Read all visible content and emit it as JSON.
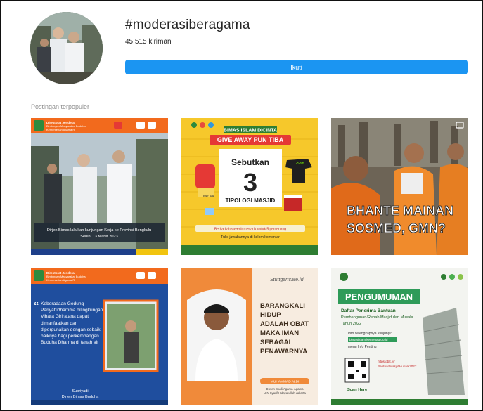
{
  "header": {
    "hashtag": "#moderasiberagama",
    "post_count": "45.515 kiriman",
    "follow_label": "Ikuti"
  },
  "section": {
    "title": "Postingan terpopuler"
  },
  "posts": [
    {
      "header_line1": "Direktorat Jenderal",
      "header_line2": "Bimbingan Masyarakat Buddha",
      "header_line3": "Kementerian Agama RI",
      "caption_line1": "Dirjen Bimas lakukan kunjungan Kerja ke Provinsi Bengkulu",
      "caption_line2": "Senin, 13 Maret 2023"
    },
    {
      "banner": "BIMAS ISLAM DICINTA",
      "ribbon": "GIVE AWAY PUN TIBA",
      "lead": "Sebutkan",
      "number": "3",
      "subject": "TIPOLOGI MASJID",
      "prize": "Berhadiah suvenir menarik untuk 5 pemenang",
      "cta": "Tulis jawabannya di kolom komentar",
      "tag_tshirt": "T-Shirt",
      "tag_tote": "Tote bag"
    },
    {
      "headline_line1": "BHANTE MAINAN",
      "headline_line2": "SOSMED, GMN?"
    },
    {
      "header_line1": "Direktorat Jenderal",
      "header_line2": "Bimbingan Masyarakat Buddha",
      "header_line3": "Kementerian Agama RI",
      "quote": "Keberadaan Gedung Pariyattidhamma dilingkungan Vihara Giriratana dapat dimanfaatkan dan dipergunakan dengan sebaik-baiknya bagi perkembangan Buddha Dharma di tanah air",
      "author": "Supriyadi",
      "role": "Dirjen Bimas Buddha"
    },
    {
      "brand": "Stuttgartcare.id",
      "quote_line1": "BARANGKALI",
      "quote_line2": "HIDUP",
      "quote_line3": "ADALAH OBAT",
      "quote_line4": "MAKA IMAN",
      "quote_line5": "SEBAGAI",
      "quote_line6": "PENAWARNYA",
      "name": "MUHAMMAD ALBI",
      "role_line1": "Dosen Studi Agama-Agama",
      "role_line2": "UIN Syarif Hidayatullah Jakarta"
    },
    {
      "title": "PENGUMUMAN",
      "subtitle_line1": "Daftar Penerima Bantuan",
      "subtitle_line2": "Pembangunan/Rehab Masjid dan Musala",
      "subtitle_line3": "Tahun 2022",
      "info": "Info selengkapnya kunjungi:",
      "url": "bimasislam.kemenag.go.id",
      "menu": "menu Info Penting",
      "scan": "Scan Here",
      "short_url": "https://bit.ly/",
      "short_path": "BantuanMasjidMusala2022"
    }
  ],
  "colors": {
    "follow_button": "#1b95f2",
    "hashtag_text": "#262626",
    "muted_text": "#8e8e8e"
  }
}
